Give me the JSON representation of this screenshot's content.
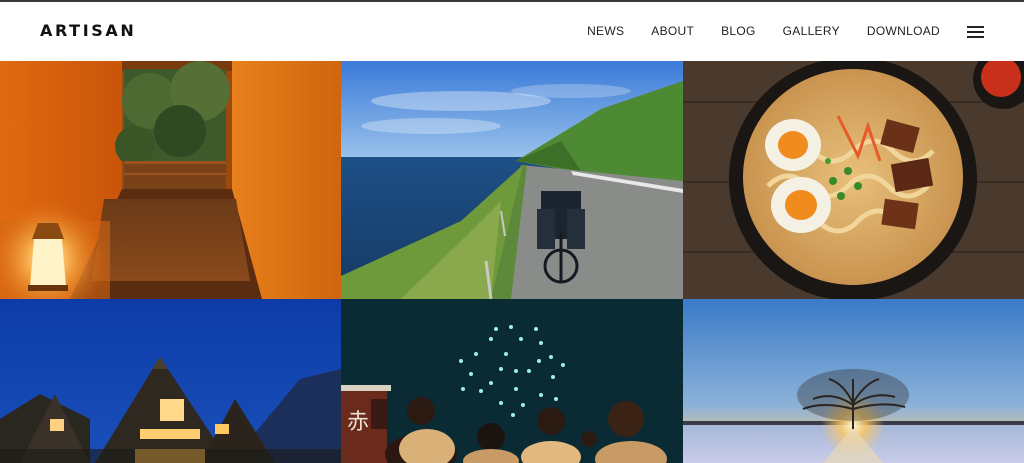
{
  "header": {
    "logo": "ARTISAN",
    "nav": [
      "NEWS",
      "ABOUT",
      "BLOG",
      "GALLERY",
      "DOWNLOAD"
    ],
    "menu_icon": "hamburger-menu-icon"
  },
  "gallery": {
    "photos": [
      "onsen-bath-photo",
      "coastal-road-bicycle-photo",
      "ramen-bowl-photo",
      "thatched-farmhouse-night-photo",
      "fireworks-festival-photo",
      "lone-tree-snow-sunset-photo"
    ]
  },
  "colors": {
    "header_bg": "#ffffff",
    "text": "#222222",
    "top_border": "#3a3a3a"
  }
}
